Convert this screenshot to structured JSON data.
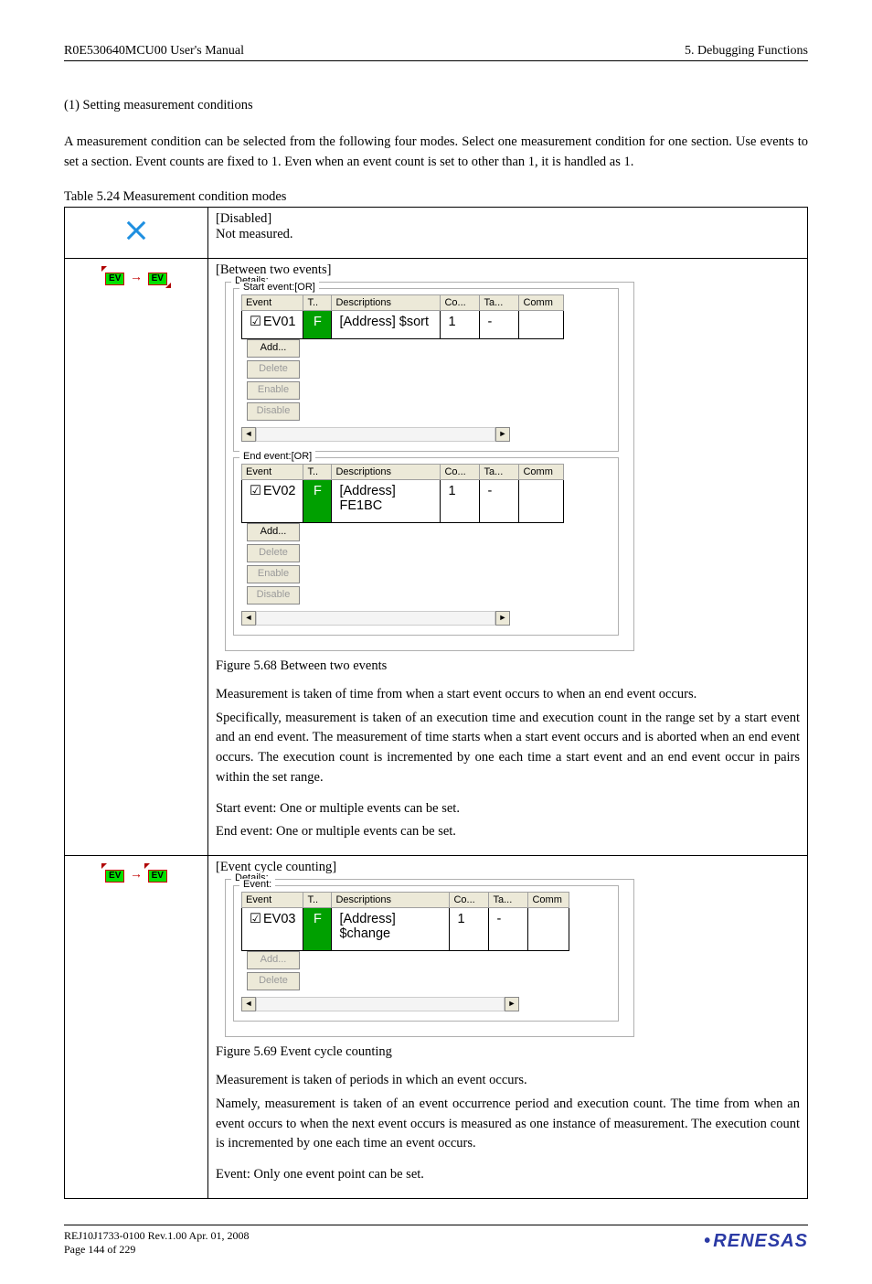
{
  "header": {
    "left": "R0E530640MCU00 User's Manual",
    "right": "5. Debugging Functions"
  },
  "section_heading": "(1) Setting measurement conditions",
  "intro_paragraph": "A measurement condition can be selected from the following four modes. Select one measurement condition for one section. Use events to set a section. Event counts are fixed to 1. Even when an event count is set to other than 1, it is handled as 1.",
  "table_caption": "Table 5.24 Measurement condition modes",
  "row1": {
    "title": "[Disabled]",
    "text": "Not measured."
  },
  "row2": {
    "title": "[Between two events]",
    "details_label": "Details:",
    "start_legend": "Start event:[OR]",
    "end_legend": "End event:[OR]",
    "headers": {
      "event": "Event",
      "t": "T..",
      "desc": "Descriptions",
      "co": "Co...",
      "ta": "Ta...",
      "comm": "Comm"
    },
    "start_row": {
      "event": "EV01",
      "f": "F",
      "desc": "[Address] $sort",
      "co": "1",
      "ta": "-",
      "comm": ""
    },
    "end_row": {
      "event": "EV02",
      "f": "F",
      "desc": "[Address] FE1BC",
      "co": "1",
      "ta": "-",
      "comm": ""
    },
    "buttons": {
      "add": "Add...",
      "delete": "Delete",
      "enable": "Enable",
      "disable": "Disable"
    },
    "fig_caption": "Figure 5.68 Between two events",
    "p1": "Measurement is taken of time from when a start event occurs to when an end event occurs.",
    "p2": "Specifically, measurement is taken of an execution time and execution count in the range set by a start event and an end event. The measurement of time starts when a start event occurs and is aborted when an end event occurs. The execution count is incremented by one each time a start event and an end event occur in pairs within the set range.",
    "p3": "Start event: One or multiple events can be set.",
    "p4": "End event: One or multiple events can be set."
  },
  "row3": {
    "title": "[Event cycle counting]",
    "details_label": "Details:",
    "event_legend": "Event:",
    "headers": {
      "event": "Event",
      "t": "T..",
      "desc": "Descriptions",
      "co": "Co...",
      "ta": "Ta...",
      "comm": "Comm"
    },
    "row": {
      "event": "EV03",
      "f": "F",
      "desc": "[Address] $change",
      "co": "1",
      "ta": "-",
      "comm": ""
    },
    "buttons": {
      "add": "Add...",
      "delete": "Delete"
    },
    "fig_caption": "Figure 5.69 Event cycle counting",
    "p1": "Measurement is taken of periods in which an event occurs.",
    "p2": "Namely, measurement is taken of an event occurrence period and execution count. The time from when an event occurs to when the next event occurs is measured as one instance of measurement. The execution count is incremented by one each time an event occurs.",
    "p3": "Event: Only one event point can be set."
  },
  "footer": {
    "line1": "REJ10J1733-0100   Rev.1.00   Apr. 01, 2008",
    "line2": "Page 144 of 229",
    "logo": "RENESAS"
  },
  "ev_label": "EV"
}
